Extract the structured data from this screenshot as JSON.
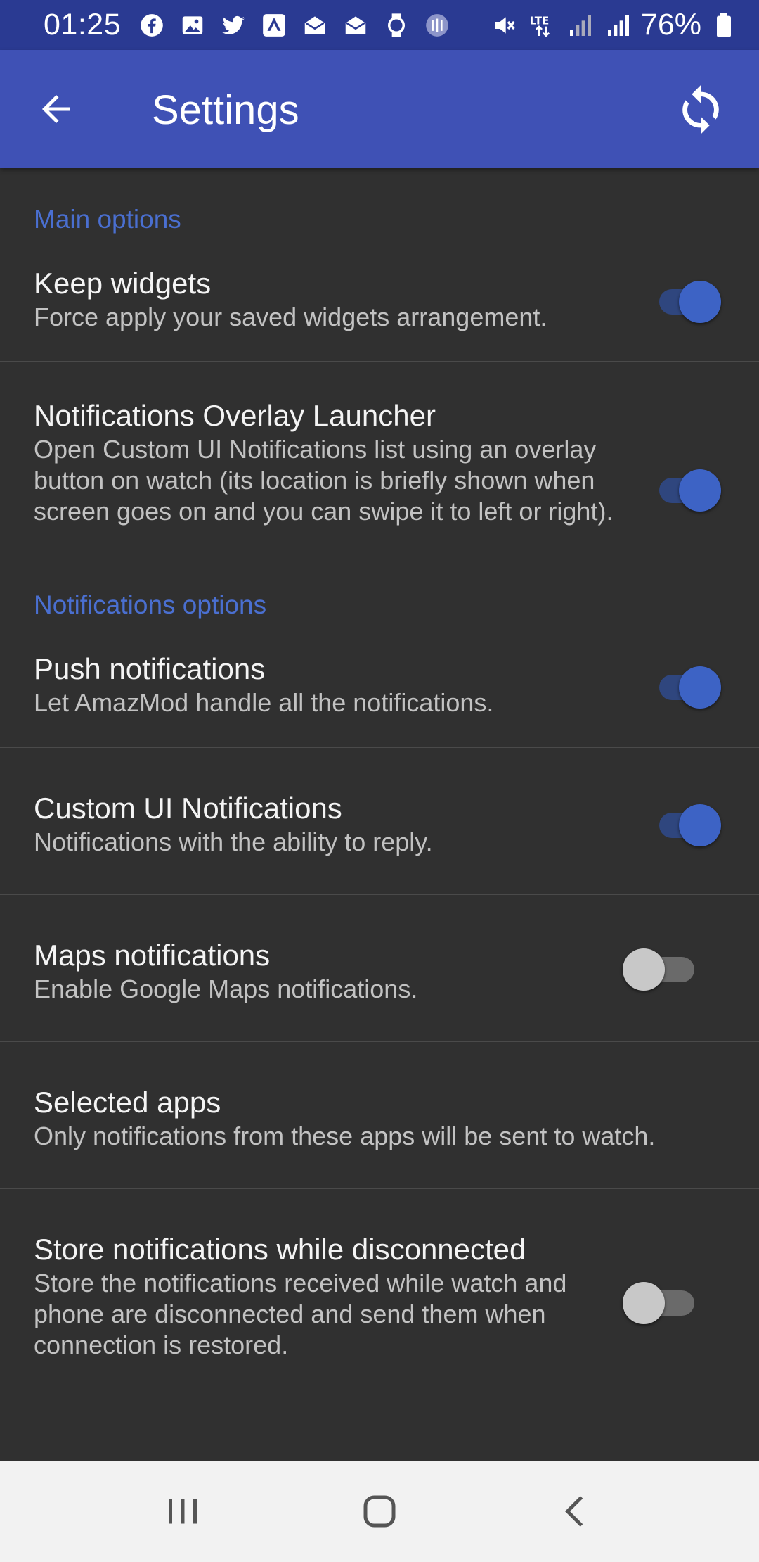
{
  "status_bar": {
    "time": "01:25",
    "battery": "76%",
    "notification_icons": [
      "facebook-icon",
      "gallery-icon",
      "twitter-icon",
      "store-icon",
      "mail-icon",
      "mail-icon",
      "watch-icon",
      "app-icon"
    ],
    "system_icons": [
      "mute-icon",
      "lte-icon",
      "signal-icon",
      "signal-icon",
      "battery-icon"
    ]
  },
  "app_bar": {
    "title": "Settings",
    "back_icon": "arrow-left-icon",
    "action_icon": "sync-icon"
  },
  "sections": [
    {
      "header": "Main options",
      "items": [
        {
          "title": "Keep widgets",
          "summary": "Force apply your saved widgets arrangement.",
          "switch": true
        },
        {
          "title": "Notifications Overlay Launcher",
          "summary": "Open Custom UI Notifications list using an overlay button on watch (its location is briefly shown when screen goes on and you can swipe it to left or right).",
          "switch": true
        }
      ]
    },
    {
      "header": "Notifications options",
      "items": [
        {
          "title": "Push notifications",
          "summary": "Let AmazMod handle all the notifications.",
          "switch": true
        },
        {
          "title": "Custom UI Notifications",
          "summary": "Notifications with the ability to reply.",
          "switch": true
        },
        {
          "title": "Maps notifications",
          "summary": "Enable Google Maps notifications.",
          "switch": false
        },
        {
          "title": "Selected apps",
          "summary": "Only notifications from these apps will be sent to watch.",
          "switch": null
        },
        {
          "title": "Store notifications while disconnected",
          "summary": "Store the notifications received while watch and phone are disconnected and send them when connection is restored.",
          "switch": false
        }
      ]
    }
  ],
  "colors": {
    "status_bar": "#2a3a92",
    "app_bar": "#3f51b5",
    "background": "#303030",
    "accent": "#4a6fd0",
    "switch_on": "#3d63c5",
    "switch_off": "#c8c8c8",
    "nav_bar": "#f2f2f2"
  },
  "nav_bar": {
    "buttons": [
      "recents-icon",
      "home-icon",
      "back-icon"
    ]
  }
}
